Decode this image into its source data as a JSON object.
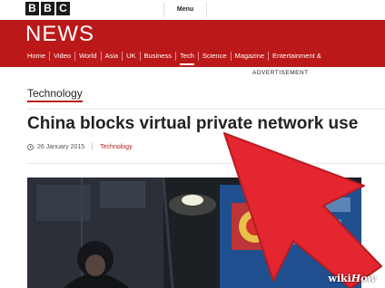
{
  "header": {
    "logo_letters": [
      "B",
      "B",
      "C"
    ],
    "menu_label": "Menu",
    "brand_title": "NEWS"
  },
  "nav": {
    "items": [
      "Home",
      "Video",
      "World",
      "Asia",
      "UK",
      "Business",
      "Tech",
      "Science",
      "Magazine",
      "Entertainment &"
    ],
    "active": "Tech"
  },
  "advertisement_label": "ADVERTISEMENT",
  "article": {
    "section": "Technology",
    "headline": "China blocks virtual private network use",
    "date": "26 January 2015",
    "topic": "Technology"
  },
  "watermark": {
    "wiki": "wiki",
    "how": "How"
  },
  "colors": {
    "brand_red": "#bb1919",
    "arrow_red": "#e3262f"
  },
  "icons": [
    "clock-icon",
    "pointer-arrow-icon"
  ]
}
